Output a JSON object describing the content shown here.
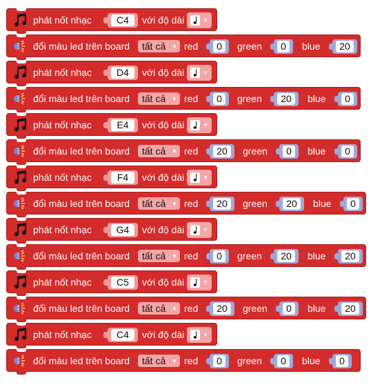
{
  "colors": {
    "block": "#d42b2b",
    "block_border": "#a51d1d",
    "note_chip": "#ef9a9a",
    "dropdown_chip": "#f5a5a5",
    "number_chip": "#9fa8da",
    "field": "#fafafa"
  },
  "blocks": [
    {
      "kind": "note",
      "icon": "music-note-icon",
      "label": "phát nốt nhạc",
      "note": "C4",
      "duration_label": "với độ dài",
      "duration_icon": "quarter-note-icon"
    },
    {
      "kind": "led",
      "icon": "led-light-icon",
      "label": "đổi màu led trên board",
      "target": "tất cả",
      "red_label": "red",
      "red": "0",
      "green_label": "green",
      "green": "0",
      "blue_label": "blue",
      "blue": "20"
    },
    {
      "kind": "note",
      "icon": "music-note-icon",
      "label": "phát nốt nhạc",
      "note": "D4",
      "duration_label": "với độ dài",
      "duration_icon": "quarter-note-icon"
    },
    {
      "kind": "led",
      "icon": "led-light-icon",
      "label": "đổi màu led trên board",
      "target": "tất cả",
      "red_label": "red",
      "red": "0",
      "green_label": "green",
      "green": "20",
      "blue_label": "blue",
      "blue": "0"
    },
    {
      "kind": "note",
      "icon": "music-note-icon",
      "label": "phát nốt nhạc",
      "note": "E4",
      "duration_label": "với độ dài",
      "duration_icon": "quarter-note-icon"
    },
    {
      "kind": "led",
      "icon": "led-light-icon",
      "label": "đổi màu led trên board",
      "target": "tất cả",
      "red_label": "red",
      "red": "20",
      "green_label": "green",
      "green": "0",
      "blue_label": "blue",
      "blue": "0"
    },
    {
      "kind": "note",
      "icon": "music-note-icon",
      "label": "phát nốt nhạc",
      "note": "F4",
      "duration_label": "với độ dài",
      "duration_icon": "quarter-note-icon"
    },
    {
      "kind": "led",
      "icon": "led-light-icon",
      "label": "đổi màu led trên board",
      "target": "tất cả",
      "red_label": "red",
      "red": "20",
      "green_label": "green",
      "green": "20",
      "blue_label": "blue",
      "blue": "0"
    },
    {
      "kind": "note",
      "icon": "music-note-icon",
      "label": "phát nốt nhạc",
      "note": "G4",
      "duration_label": "với độ dài",
      "duration_icon": "quarter-note-icon"
    },
    {
      "kind": "led",
      "icon": "led-light-icon",
      "label": "đổi màu led trên board",
      "target": "tất cả",
      "red_label": "red",
      "red": "0",
      "green_label": "green",
      "green": "20",
      "blue_label": "blue",
      "blue": "20"
    },
    {
      "kind": "note",
      "icon": "music-note-icon",
      "label": "phát nốt nhạc",
      "note": "C5",
      "duration_label": "với độ dài",
      "duration_icon": "quarter-note-icon"
    },
    {
      "kind": "led",
      "icon": "led-light-icon",
      "label": "đổi màu led trên board",
      "target": "tất cả",
      "red_label": "red",
      "red": "20",
      "green_label": "green",
      "green": "0",
      "blue_label": "blue",
      "blue": "20"
    },
    {
      "kind": "note",
      "icon": "music-note-icon",
      "label": "phát nốt nhạc",
      "note": "C4",
      "duration_label": "với độ dài",
      "duration_icon": "quarter-note-icon"
    },
    {
      "kind": "led",
      "icon": "led-light-icon",
      "label": "đổi màu led trên board",
      "target": "tất cả",
      "red_label": "red",
      "red": "0",
      "green_label": "green",
      "green": "0",
      "blue_label": "blue",
      "blue": "0"
    }
  ]
}
